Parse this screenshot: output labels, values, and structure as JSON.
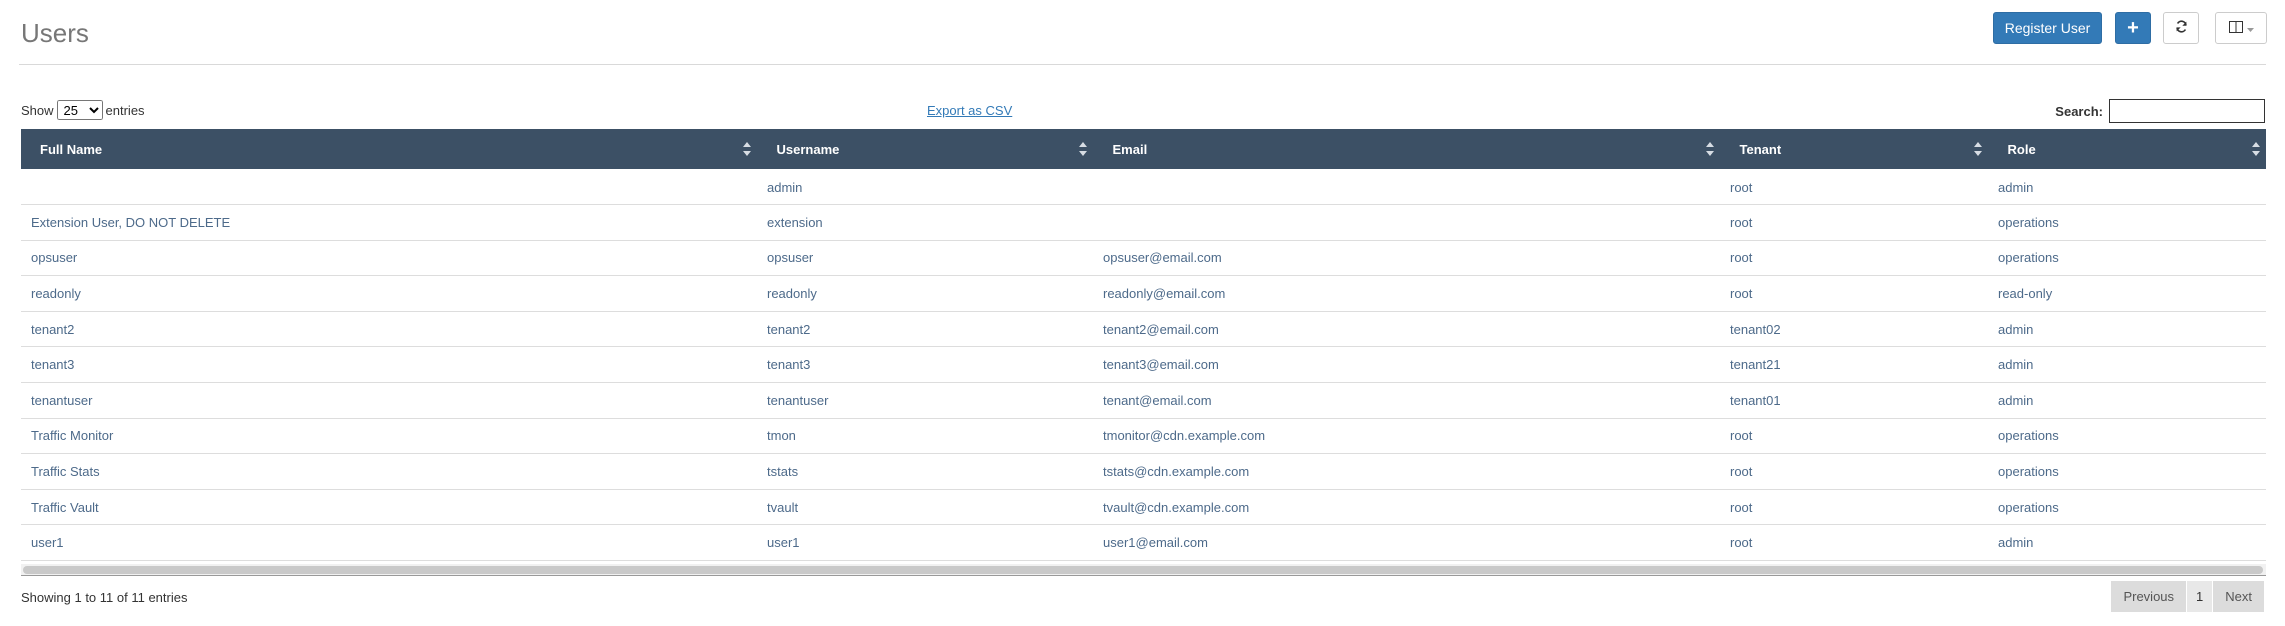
{
  "page": {
    "title": "Users"
  },
  "toolbar": {
    "register_label": "Register User",
    "add_label": "+",
    "refresh_icon": "refresh-icon",
    "columns_icon": "columns-icon"
  },
  "controls": {
    "show_label": "Show",
    "page_length": "25",
    "entries_label": "entries",
    "export_label": "Export as CSV",
    "search_label": "Search:",
    "search_value": ""
  },
  "table": {
    "columns": [
      "Full Name",
      "Username",
      "Email",
      "Tenant",
      "Role"
    ],
    "rows": [
      [
        "",
        "admin",
        "",
        "root",
        "admin"
      ],
      [
        "Extension User, DO NOT DELETE",
        "extension",
        "",
        "root",
        "operations"
      ],
      [
        "opsuser",
        "opsuser",
        "opsuser@email.com",
        "root",
        "operations"
      ],
      [
        "readonly",
        "readonly",
        "readonly@email.com",
        "root",
        "read-only"
      ],
      [
        "tenant2",
        "tenant2",
        "tenant2@email.com",
        "tenant02",
        "admin"
      ],
      [
        "tenant3",
        "tenant3",
        "tenant3@email.com",
        "tenant21",
        "admin"
      ],
      [
        "tenantuser",
        "tenantuser",
        "tenant@email.com",
        "tenant01",
        "admin"
      ],
      [
        "Traffic Monitor",
        "tmon",
        "tmonitor@cdn.example.com",
        "root",
        "operations"
      ],
      [
        "Traffic Stats",
        "tstats",
        "tstats@cdn.example.com",
        "root",
        "operations"
      ],
      [
        "Traffic Vault",
        "tvault",
        "tvault@cdn.example.com",
        "root",
        "operations"
      ],
      [
        "user1",
        "user1",
        "user1@email.com",
        "root",
        "admin"
      ]
    ]
  },
  "footer": {
    "info": "Showing 1 to 11 of 11 entries",
    "previous_label": "Previous",
    "current_page": "1",
    "next_label": "Next"
  },
  "colors": {
    "header_bg": "#3c5065",
    "primary_button": "#337ab7",
    "link_text": "#4d6a8a"
  }
}
